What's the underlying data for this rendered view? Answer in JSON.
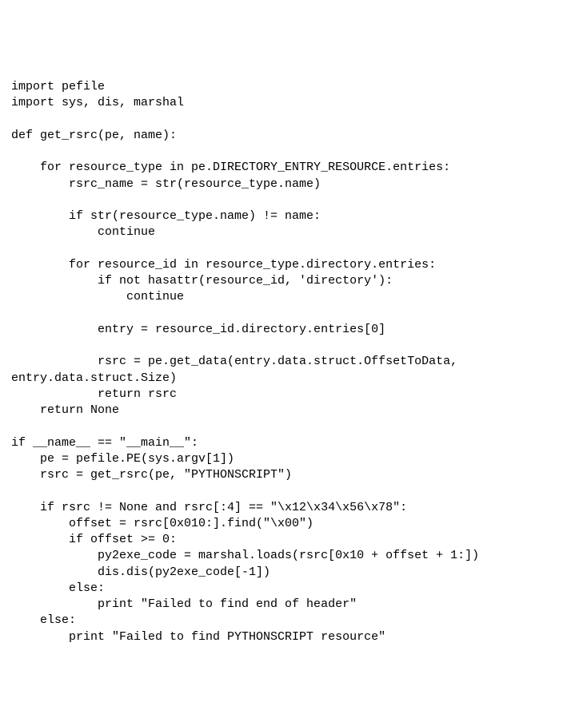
{
  "code": {
    "line01": "import pefile",
    "line02": "import sys, dis, marshal",
    "line03": "",
    "line04": "def get_rsrc(pe, name):",
    "line05": "",
    "line06": "    for resource_type in pe.DIRECTORY_ENTRY_RESOURCE.entries:",
    "line07": "        rsrc_name = str(resource_type.name)",
    "line08": "",
    "line09": "        if str(resource_type.name) != name:",
    "line10": "            continue",
    "line11": "",
    "line12": "        for resource_id in resource_type.directory.entries:",
    "line13": "            if not hasattr(resource_id, 'directory'):",
    "line14": "                continue",
    "line15": "",
    "line16": "            entry = resource_id.directory.entries[0]",
    "line17": "",
    "line18": "            rsrc = pe.get_data(entry.data.struct.OffsetToData,",
    "line19": "entry.data.struct.Size)",
    "line20": "            return rsrc",
    "line21": "    return None",
    "line22": "",
    "line23": "if __name__ == \"__main__\":",
    "line24": "    pe = pefile.PE(sys.argv[1])",
    "line25": "    rsrc = get_rsrc(pe, \"PYTHONSCRIPT\")",
    "line26": "",
    "line27": "    if rsrc != None and rsrc[:4] == \"\\x12\\x34\\x56\\x78\":",
    "line28": "        offset = rsrc[0x010:].find(\"\\x00\")",
    "line29": "        if offset >= 0:",
    "line30": "            py2exe_code = marshal.loads(rsrc[0x10 + offset + 1:])",
    "line31": "            dis.dis(py2exe_code[-1])",
    "line32": "        else:",
    "line33": "            print \"Failed to find end of header\"",
    "line34": "    else:",
    "line35": "        print \"Failed to find PYTHONSCRIPT resource\""
  }
}
